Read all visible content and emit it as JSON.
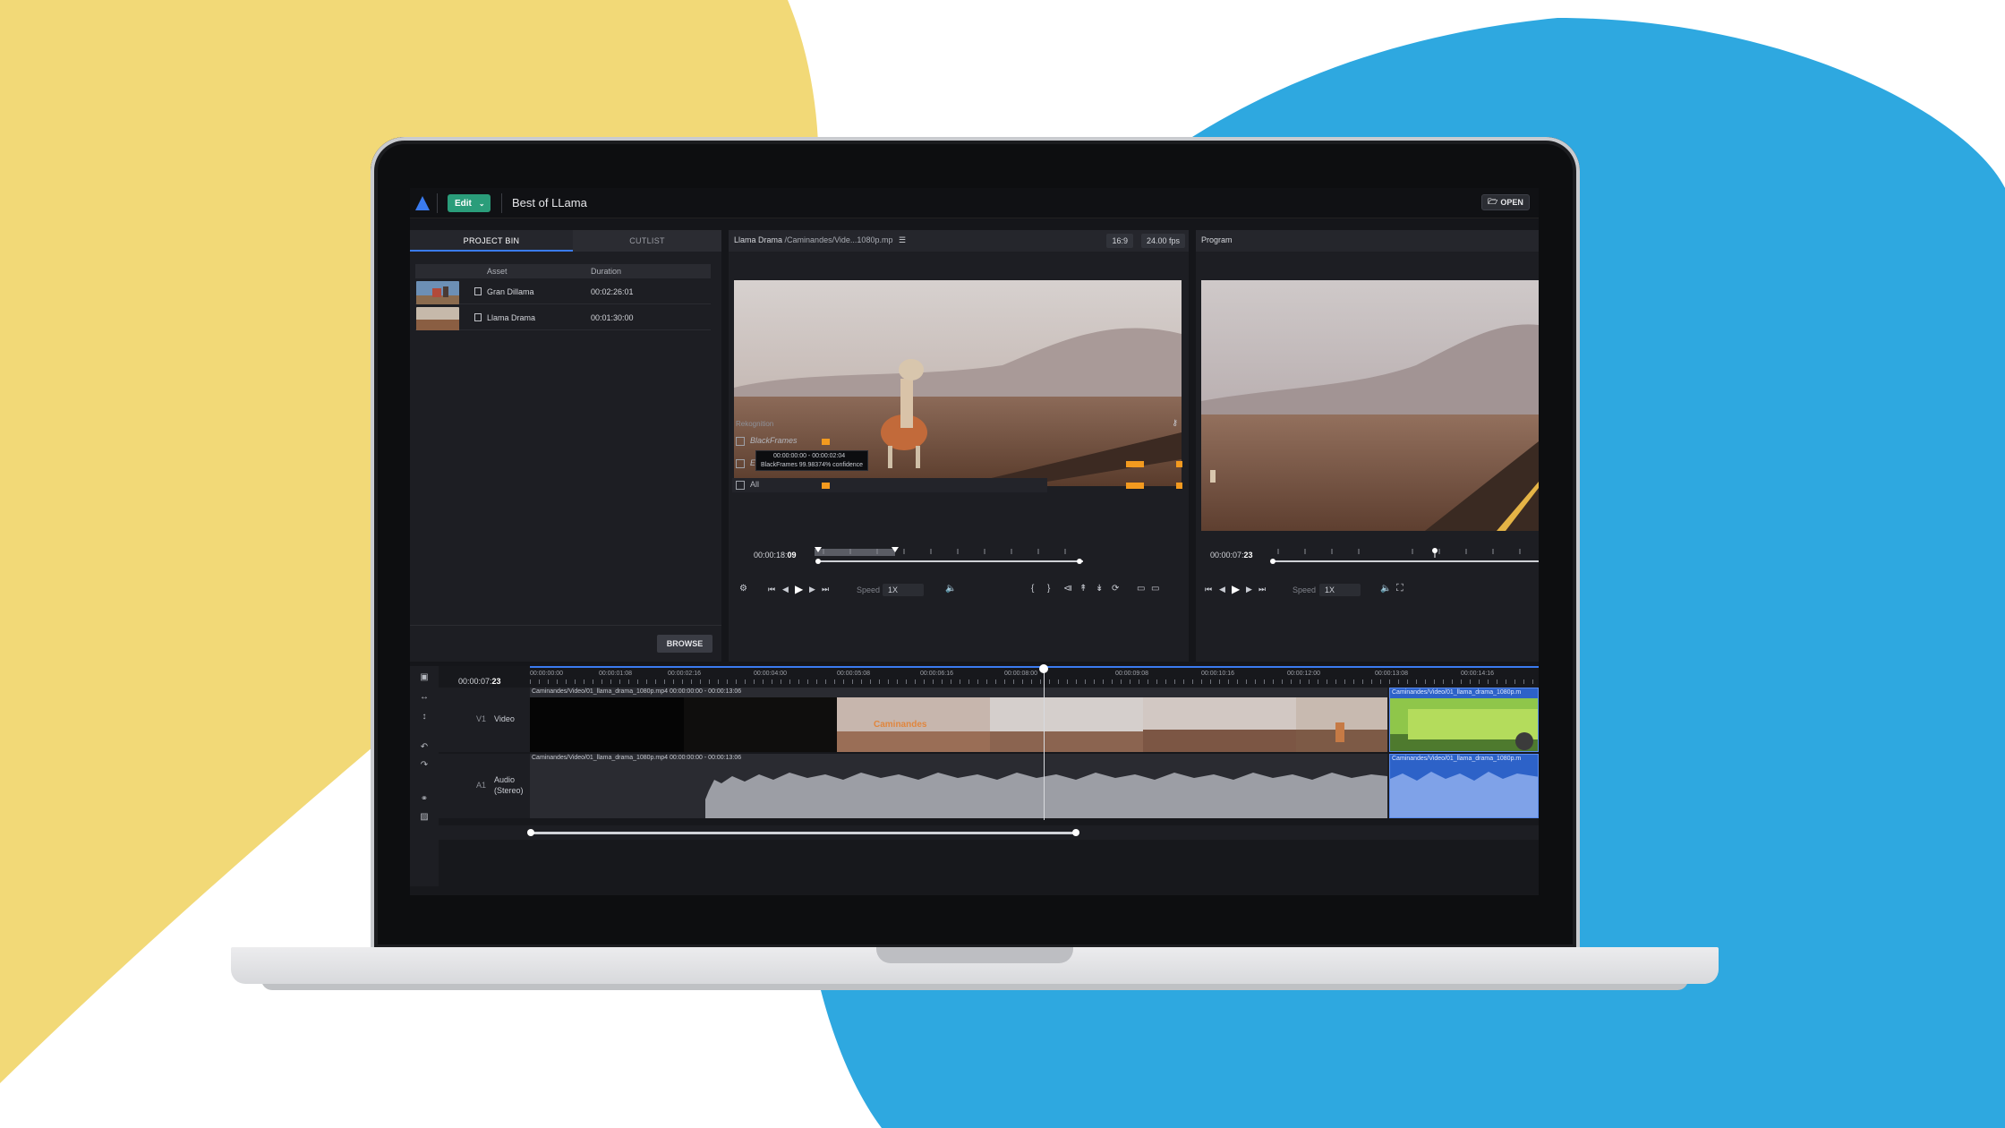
{
  "app": {
    "edit_label": "Edit",
    "project_title": "Best of LLama",
    "open_label": "OPEN"
  },
  "bin": {
    "tabs": [
      "PROJECT BIN",
      "CUTLIST"
    ],
    "col_asset": "Asset",
    "col_duration": "Duration",
    "items": [
      {
        "name": "Gran Dillama",
        "duration": "00:02:26:01"
      },
      {
        "name": "Llama Drama",
        "duration": "00:01:30:00"
      }
    ],
    "browse_label": "BROWSE"
  },
  "source": {
    "title": "Llama Drama",
    "path": "/Caminandes/Vide...1080p.mp",
    "aspect": "16:9",
    "fps": "24.00 fps",
    "rek_label": "Rekognition",
    "rows": [
      "BlackFrames",
      "E",
      "All"
    ],
    "tooltip_time": "00:00:00:00 - 00:00:02:04",
    "tooltip_conf": "BlackFrames 99.98374% confidence",
    "timecode_main": "00:00:18:",
    "timecode_frames": "09",
    "speed_label": "Speed",
    "speed_value": "1X"
  },
  "program": {
    "title": "Program",
    "timecode_main": "00:00:07:",
    "timecode_frames": "23",
    "speed_label": "Speed",
    "speed_value": "1X"
  },
  "timeline": {
    "timecode_main": "00:00:07:",
    "timecode_frames": "23",
    "ruler": [
      "00:00:00:00",
      "00:00:01:08",
      "00:00:02:16",
      "00:00:04:00",
      "00:00:05:08",
      "00:00:06:16",
      "00:00:08:00",
      "00:00:09:08",
      "00:00:10:16",
      "00:00:12:00",
      "00:00:13:08",
      "00:00:14:16"
    ],
    "video_track": {
      "id": "V1",
      "name": "Video"
    },
    "audio_track": {
      "id": "A1",
      "name": "Audio",
      "sub": "(Stereo)"
    },
    "clip_main_label": "Caminandes/Video/01_llama_drama_1080p.mp4   00:00:00:00 - 00:00:13:06",
    "clip_next_label": "Caminandes/Video/01_llama_drama_1080p.m",
    "title_card": "Caminandes"
  },
  "colors": {
    "accent": "#3a7bf0",
    "edit_green": "#2a9d7a",
    "orange_marker": "#f39a1f",
    "bg_yellow": "#f2d977",
    "bg_blue": "#2ea8e0"
  }
}
